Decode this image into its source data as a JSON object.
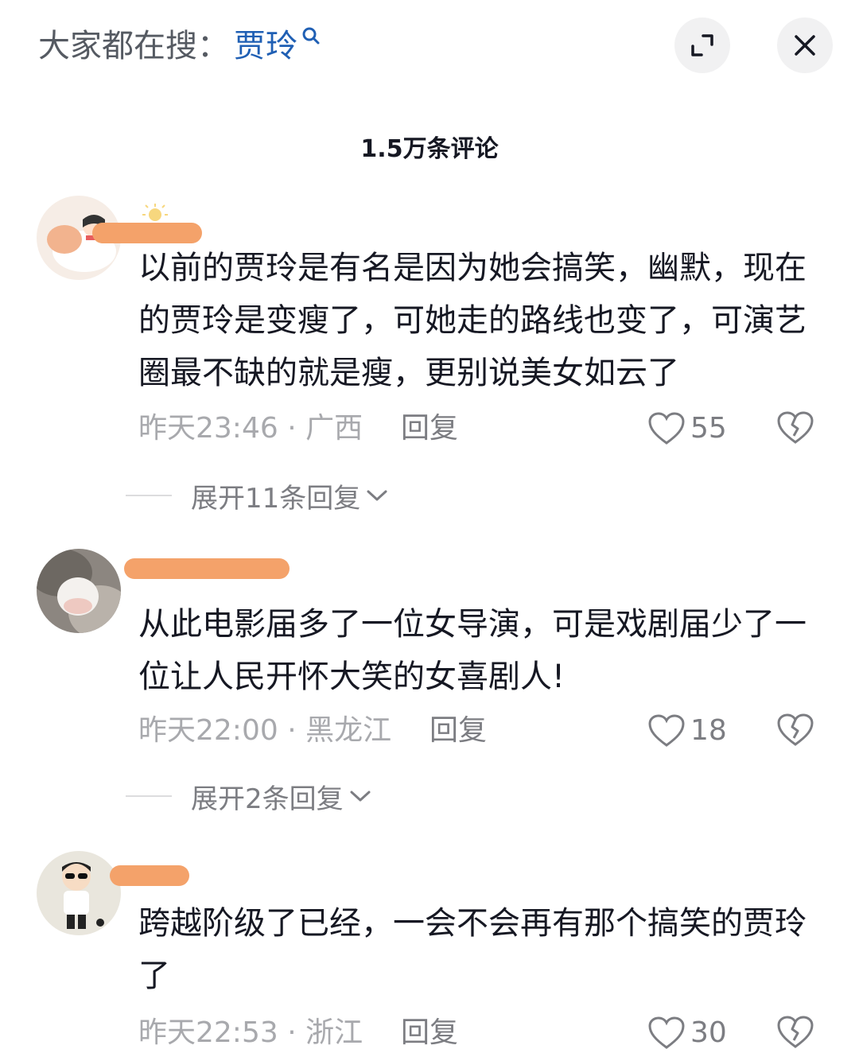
{
  "header": {
    "search_prefix": "大家都在搜：",
    "search_term": "贾玲",
    "icons": {
      "search_sup": "search-icon",
      "expand": "expand-icon",
      "close": "close-icon"
    }
  },
  "comment_count": "1.5万条评论",
  "comments": [
    {
      "text": "以前的贾玲是有名是因为她会搞笑，幽默，现在的贾玲是变瘦了，可她走的路线也变了，可演艺圈最不缺的就是瘦，更别说美女如云了",
      "time_location": "昨天23:46 · 广西",
      "reply_label": "回复",
      "likes": "55",
      "expand_label": "展开11条回复"
    },
    {
      "text": "从此电影届多了一位女导演，可是戏剧届少了一位让人民开怀大笑的女喜剧人!",
      "time_location": "昨天22:00 · 黑龙江",
      "reply_label": "回复",
      "likes": "18",
      "expand_label": "展开2条回复"
    },
    {
      "text": "跨越阶级了已经，一会不会再有那个搞笑的贾玲了",
      "time_location": "昨天22:53 · 浙江",
      "reply_label": "回复",
      "likes": "30"
    }
  ],
  "colors": {
    "link_blue": "#1f5fb4",
    "redaction_orange": "#f4a26a",
    "meta_gray": "#a8a9ad"
  }
}
